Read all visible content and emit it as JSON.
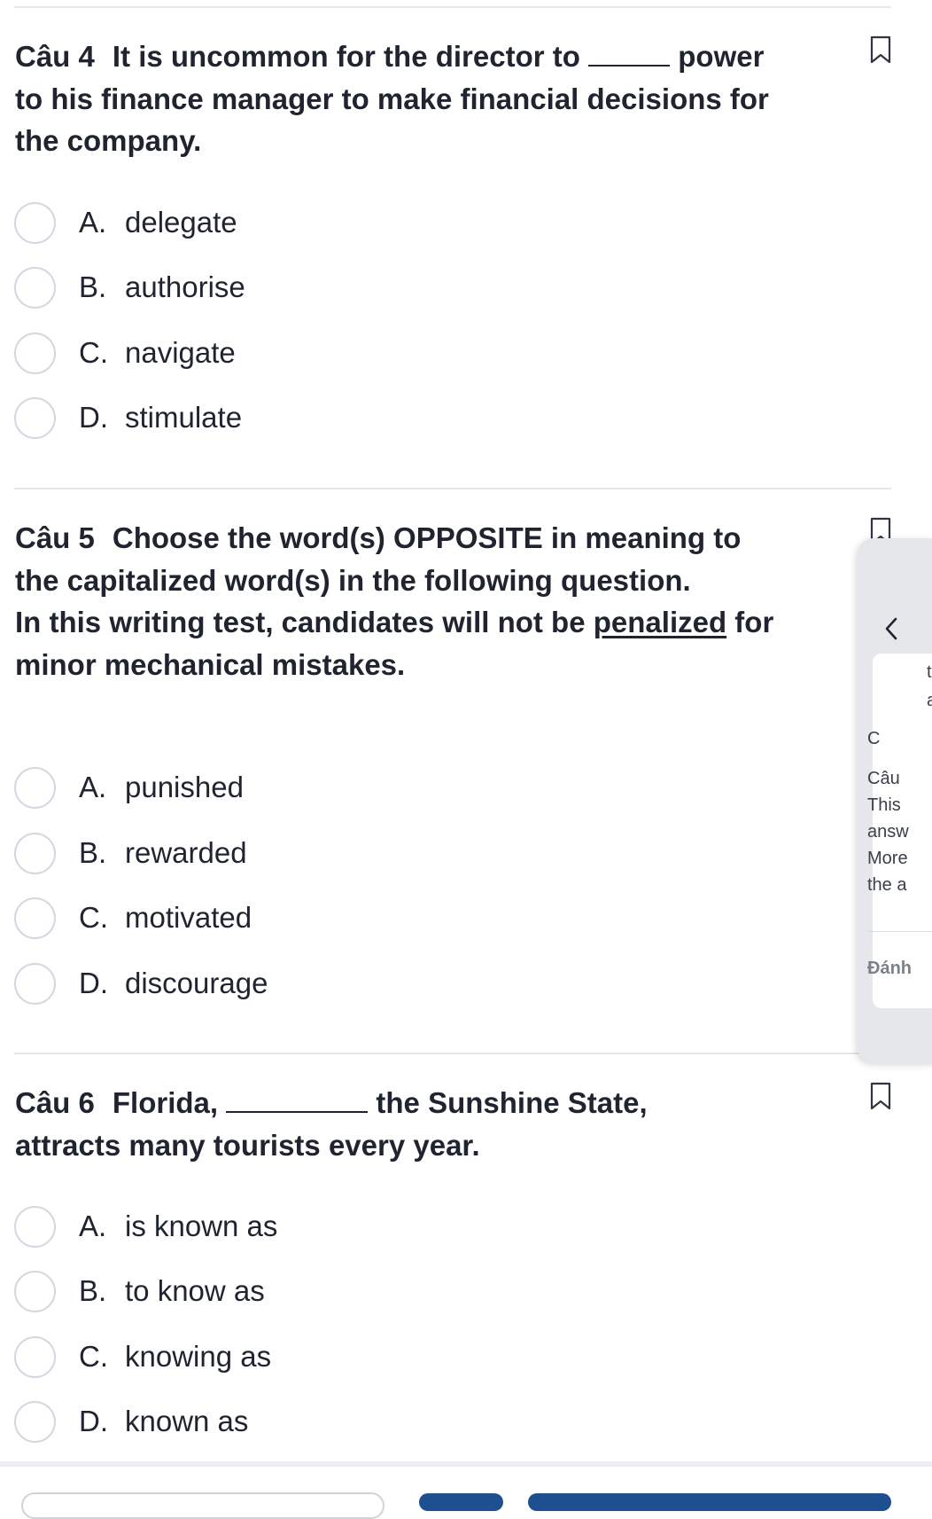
{
  "questions": [
    {
      "number": "Câu 4",
      "text_before": "It is uncommon for the director to",
      "text_after": "power to his finance manager to make financial decisions for the company.",
      "options": [
        {
          "letter": "A.",
          "text": "delegate"
        },
        {
          "letter": "B.",
          "text": "authorise"
        },
        {
          "letter": "C.",
          "text": "navigate"
        },
        {
          "letter": "D.",
          "text": "stimulate"
        }
      ]
    },
    {
      "number": "Câu 5",
      "instruction": "Choose the word(s) OPPOSITE in meaning to the capitalized word(s) in the following question.",
      "sentence_before": "In this writing test, candidates will not be",
      "sentence_keyword": "penalized",
      "sentence_after": "for minor mechanical mistakes.",
      "options": [
        {
          "letter": "A.",
          "text": "punished"
        },
        {
          "letter": "B.",
          "text": "rewarded"
        },
        {
          "letter": "C.",
          "text": "motivated"
        },
        {
          "letter": "D.",
          "text": "discourage"
        }
      ]
    },
    {
      "number": "Câu 6",
      "text_before": "Florida,",
      "text_after": "the Sunshine State,",
      "text_line2": "attracts many tourists every year.",
      "options": [
        {
          "letter": "A.",
          "text": "is known as"
        },
        {
          "letter": "B.",
          "text": "to know as"
        },
        {
          "letter": "C.",
          "text": "knowing as"
        },
        {
          "letter": "D.",
          "text": "known as"
        }
      ]
    }
  ],
  "side_panel": {
    "line1": "t",
    "line2": "a",
    "line3": "C",
    "line4": "Câu",
    "line5": "This",
    "line6": "answ",
    "line7": "More",
    "line8": "the a",
    "line9": "Đánh"
  },
  "colors": {
    "text": "#1f2430",
    "divider": "#e3e6ec",
    "radio_border": "#d3d7df",
    "primary_button": "#1d4f91"
  },
  "icons": [
    "bookmark-icon",
    "chevron-left-icon"
  ]
}
